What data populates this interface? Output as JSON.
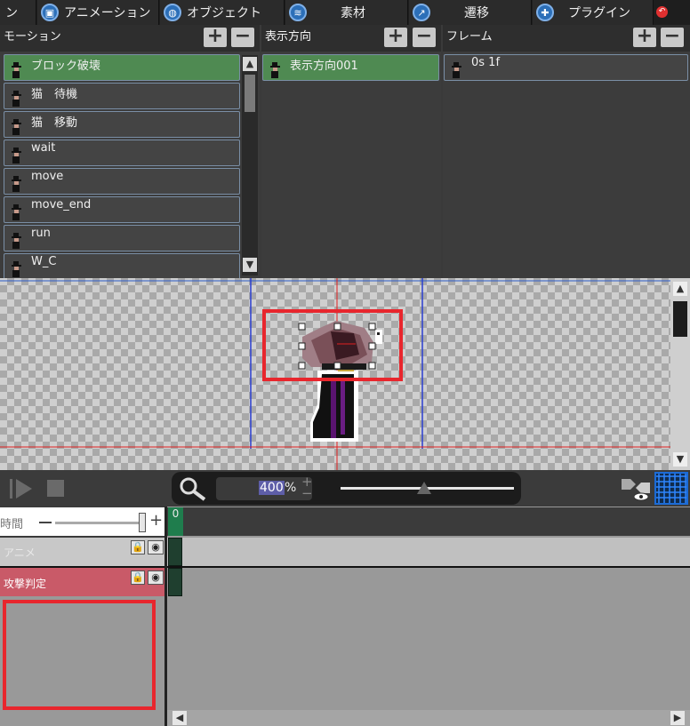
{
  "tabs": [
    {
      "label": "ン",
      "icon": "film-icon",
      "partial": true
    },
    {
      "label": "アニメーション",
      "icon": "animation-icon"
    },
    {
      "label": "オブジェクト",
      "icon": "object-icon"
    },
    {
      "label": "素材",
      "icon": "material-icon"
    },
    {
      "label": "遷移",
      "icon": "transition-icon"
    },
    {
      "label": "プラグイン",
      "icon": "plugin-icon"
    }
  ],
  "motion_panel": {
    "title": "モーション",
    "items": [
      {
        "label": "ブロック破壊",
        "selected": true
      },
      {
        "label": "猫　待機",
        "selected": false
      },
      {
        "label": "猫　移動",
        "selected": false
      },
      {
        "label": "wait",
        "selected": false
      },
      {
        "label": "move",
        "selected": false
      },
      {
        "label": "move_end",
        "selected": false
      },
      {
        "label": "run",
        "selected": false
      },
      {
        "label": "W_C",
        "selected": false
      }
    ]
  },
  "direction_panel": {
    "title": "表示方向",
    "items": [
      {
        "label": "表示方向001",
        "selected": true
      }
    ]
  },
  "frame_panel": {
    "title": "フレーム",
    "items": [
      {
        "label": "0s 1f",
        "selected": false
      }
    ]
  },
  "buttons": {
    "add": "+",
    "remove": "−"
  },
  "zoom": {
    "value": "400",
    "unit": "%",
    "plus": "+",
    "minus": "−",
    "level": 0.48
  },
  "timeline": {
    "time_label": "時間",
    "frame_zero": "0",
    "layers": [
      {
        "label": "アニメ",
        "color": "#c8c8c8"
      },
      {
        "label": "攻撃判定",
        "color": "#c95a68"
      }
    ]
  },
  "colors": {
    "selected_row": "#4f8a52",
    "highlight_red": "#e8262d",
    "attack_layer": "#c95a68",
    "grid_blue": "#1560d8"
  }
}
